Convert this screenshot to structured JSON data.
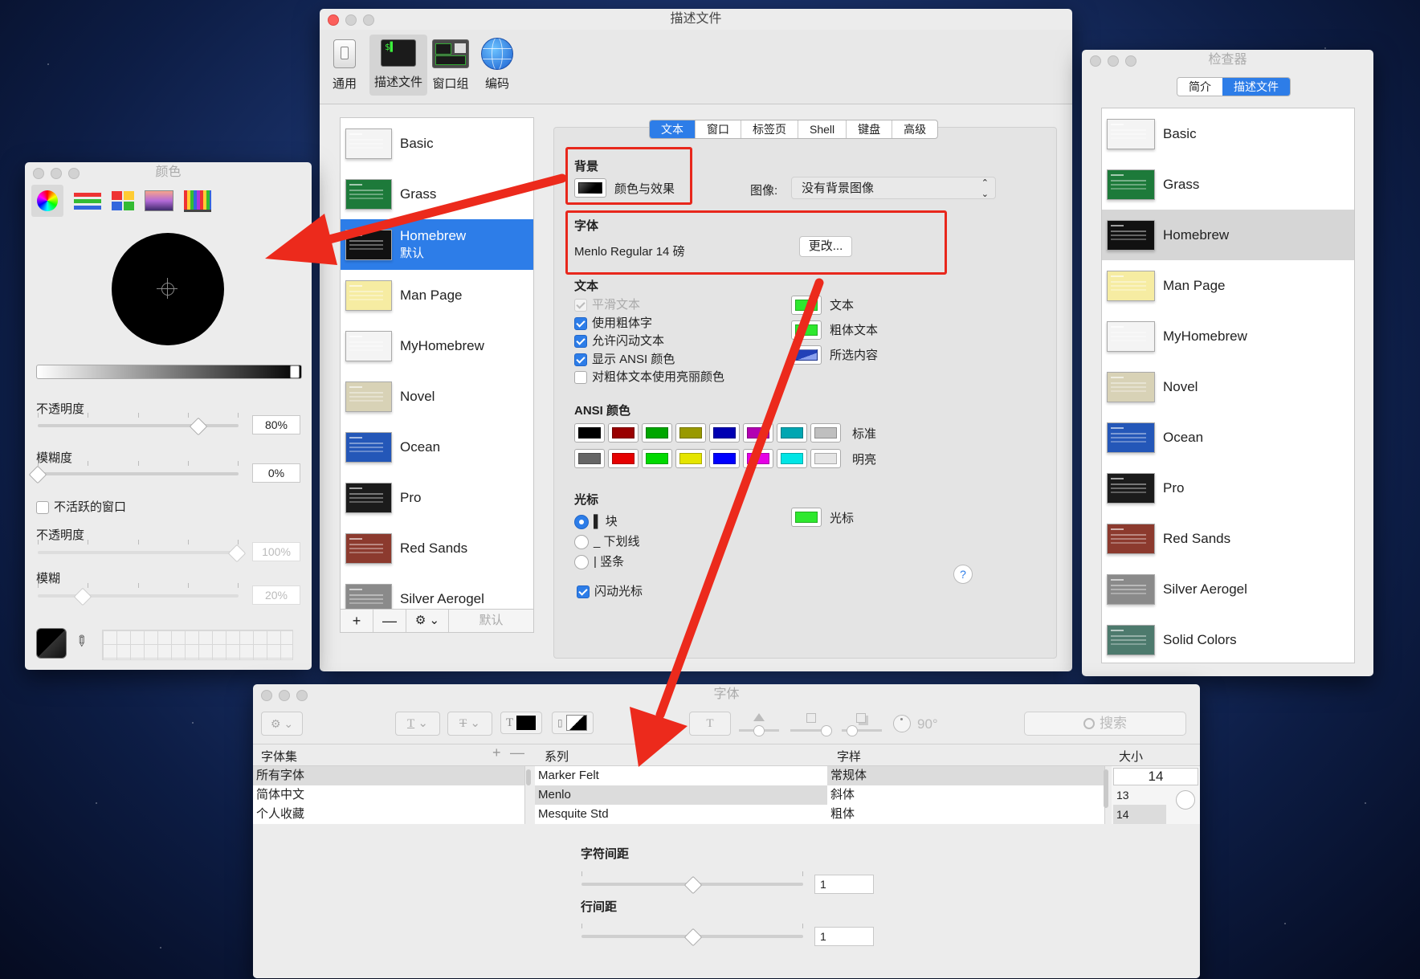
{
  "prefs": {
    "title": "描述文件",
    "toolbar": [
      {
        "label": "通用",
        "icon": "switch-icon"
      },
      {
        "label": "描述文件",
        "icon": "terminal-icon"
      },
      {
        "label": "窗口组",
        "icon": "window-group-icon"
      },
      {
        "label": "编码",
        "icon": "globe-icon"
      }
    ],
    "profiles": [
      {
        "name": "Basic",
        "color": "#f4f4f4"
      },
      {
        "name": "Grass",
        "color": "#1d7a3a"
      },
      {
        "name": "Homebrew",
        "sub": "默认",
        "color": "#111111"
      },
      {
        "name": "Man Page",
        "color": "#f6eca2"
      },
      {
        "name": "MyHomebrew",
        "color": "#f4f4f4"
      },
      {
        "name": "Novel",
        "color": "#d8d2b6"
      },
      {
        "name": "Ocean",
        "color": "#2457b8"
      },
      {
        "name": "Pro",
        "color": "#1b1b1b"
      },
      {
        "name": "Red Sands",
        "color": "#8c3a2e"
      },
      {
        "name": "Silver Aerogel",
        "color": "#8a8a8a"
      }
    ],
    "list_buttons": {
      "add": "+",
      "remove": "—",
      "gear": "⚙ ⌄",
      "default": "默认"
    },
    "tabs": [
      "文本",
      "窗口",
      "标签页",
      "Shell",
      "键盘",
      "高级"
    ],
    "background": {
      "heading": "背景",
      "color_label": "颜色与效果",
      "image_label": "图像:",
      "image_value": "没有背景图像"
    },
    "font": {
      "heading": "字体",
      "value": "Menlo Regular 14 磅",
      "change_button": "更改..."
    },
    "text": {
      "heading": "文本",
      "options": [
        {
          "label": "平滑文本",
          "state": "disabled"
        },
        {
          "label": "使用粗体字",
          "state": "on"
        },
        {
          "label": "允许闪动文本",
          "state": "on"
        },
        {
          "label": "显示 ANSI 颜色",
          "state": "on"
        },
        {
          "label": "对粗体文本使用亮丽颜色",
          "state": "off"
        }
      ],
      "colors": [
        {
          "label": "文本",
          "color": "#2ee82e"
        },
        {
          "label": "粗体文本",
          "color": "#2ee82e"
        },
        {
          "label": "所选内容",
          "color": "#2140b8"
        }
      ]
    },
    "ansi": {
      "heading": "ANSI 颜色",
      "normal_label": "标准",
      "bright_label": "明亮",
      "normal": [
        "#000000",
        "#990000",
        "#00a600",
        "#999900",
        "#0000b2",
        "#b200b2",
        "#00a6b2",
        "#bfbfbf"
      ],
      "bright": [
        "#666666",
        "#e50000",
        "#00d900",
        "#e5e500",
        "#0000ff",
        "#e500e5",
        "#00e5e5",
        "#e5e5e5"
      ]
    },
    "cursor": {
      "heading": "光标",
      "options": [
        {
          "label": "▌ 块",
          "on": true
        },
        {
          "label": "_ 下划线",
          "on": false
        },
        {
          "label": "| 竖条",
          "on": false
        }
      ],
      "blink_label": "闪动光标",
      "color_label": "光标",
      "color": "#2ee82e"
    },
    "help": "?"
  },
  "inspector": {
    "title": "检查器",
    "tabs": [
      "简介",
      "描述文件"
    ],
    "profiles": [
      {
        "name": "Basic",
        "color": "#f4f4f4"
      },
      {
        "name": "Grass",
        "color": "#1d7a3a"
      },
      {
        "name": "Homebrew",
        "color": "#111111"
      },
      {
        "name": "Man Page",
        "color": "#f6eca2"
      },
      {
        "name": "MyHomebrew",
        "color": "#f4f4f4"
      },
      {
        "name": "Novel",
        "color": "#d8d2b6"
      },
      {
        "name": "Ocean",
        "color": "#2457b8"
      },
      {
        "name": "Pro",
        "color": "#1b1b1b"
      },
      {
        "name": "Red Sands",
        "color": "#8c3a2e"
      },
      {
        "name": "Silver Aerogel",
        "color": "#8a8a8a"
      },
      {
        "name": "Solid Colors",
        "color": "#4d7a6d"
      }
    ]
  },
  "colors_panel": {
    "title": "颜色",
    "opacity_label": "不透明度",
    "opacity_value": "80%",
    "opacity_level": 0.8,
    "blur_label": "模糊度",
    "blur_value": "0%",
    "blur_level": 0,
    "inactive_label": "不活跃的窗口",
    "inactive_opacity_label": "不透明度",
    "inactive_opacity_value": "100%",
    "inactive_blur_label": "模糊",
    "inactive_blur_value": "20%"
  },
  "font_panel": {
    "title": "字体",
    "search_placeholder": "搜索",
    "angle": "90°",
    "columns": {
      "collections": "字体集",
      "family": "系列",
      "typeface": "字样",
      "size": "大小"
    },
    "collections": [
      "所有字体",
      "简体中文",
      "个人收藏"
    ],
    "families": [
      "Marker Felt",
      "Menlo",
      "Mesquite Std"
    ],
    "typefaces": [
      "常规体",
      "斜体",
      "粗体"
    ],
    "size_value": "14",
    "sizes": [
      "13",
      "14"
    ],
    "char_spacing_label": "字符间距",
    "char_spacing_value": "1",
    "line_spacing_label": "行间距",
    "line_spacing_value": "1"
  }
}
